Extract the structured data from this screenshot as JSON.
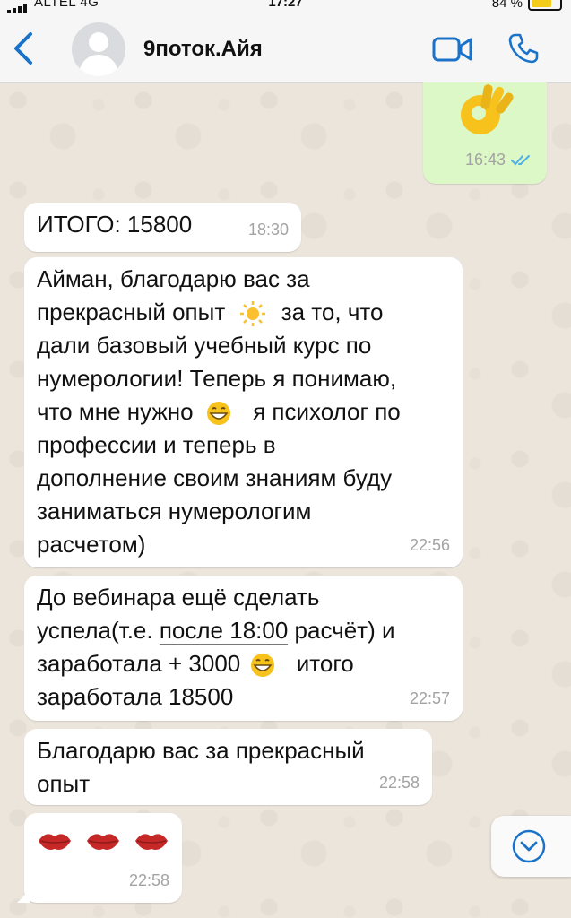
{
  "status_bar": {
    "carrier": "ALTEL 4G",
    "time": "17:27",
    "battery_percent": "84 %",
    "battery_level": 0.84
  },
  "header": {
    "contact_name": "9поток.Айя",
    "avatar_icon": "person-silhouette",
    "back_icon": "chevron-left-icon",
    "video_icon": "video-camera-icon",
    "call_icon": "phone-icon",
    "accent_color": "#1a73c8"
  },
  "messages": [
    {
      "direction": "out",
      "content_emoji": "ok-hand",
      "time": "16:43",
      "status": "read"
    },
    {
      "direction": "in",
      "text": "ИТОГО: 15800",
      "time": "18:30"
    },
    {
      "direction": "in",
      "text_lines": [
        "Айман, благодарю вас за",
        "прекрасный опыт",
        "за то, что",
        "дали базовый учебный курс по",
        "нумерологии! Теперь я понимаю,",
        "что мне нужно",
        "я психолог по",
        "профессии и теперь в",
        "дополнение своим знаниям буду",
        "заниматься нумерологим",
        "расчетом)"
      ],
      "emojis": [
        "sun",
        "grinning-face"
      ],
      "time": "22:56"
    },
    {
      "direction": "in",
      "text_parts": {
        "line1": "До вебинара ещё сделать",
        "line2_before": "успела(т.е. ",
        "line2_link": "после 18:00",
        "line2_after": " расчёт) и",
        "line3_before": "заработала + 3000",
        "line3_after": "итого",
        "line4": "заработала 18500"
      },
      "emojis": [
        "grinning-face"
      ],
      "time": "22:57"
    },
    {
      "direction": "in",
      "text_lines": [
        "Благодарю вас за прекрасный",
        "опыт"
      ],
      "time": "22:58"
    },
    {
      "direction": "in",
      "content_emoji": "kiss-mark x3",
      "time": "22:58"
    }
  ],
  "scroll_button_icon": "chevron-down-circle-icon"
}
